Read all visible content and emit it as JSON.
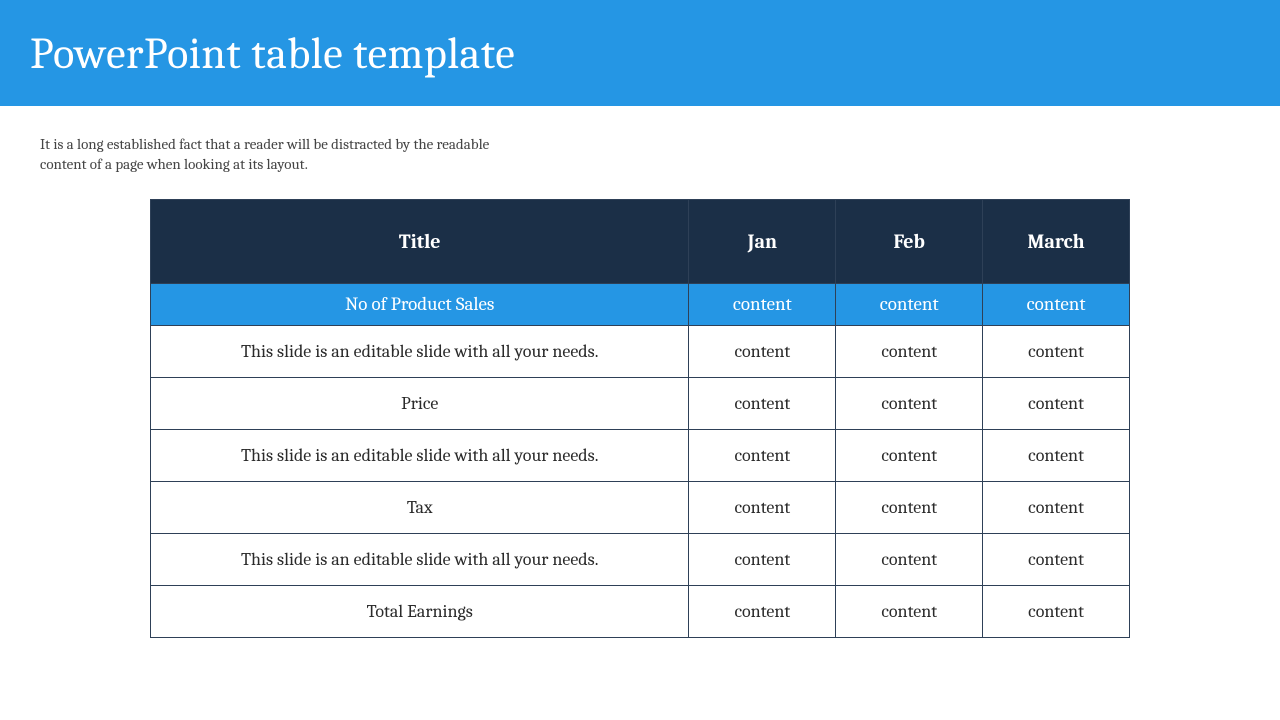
{
  "title": "PowerPoint table template",
  "subtitle": "It is a long established fact that a reader will be distracted by the readable content of a page when looking at its layout.",
  "table": {
    "headers": [
      "Title",
      "Jan",
      "Feb",
      "March"
    ],
    "rows": [
      {
        "highlight": true,
        "cells": [
          "No of Product Sales",
          "content",
          "content",
          "content"
        ]
      },
      {
        "highlight": false,
        "cells": [
          "This slide is an editable slide with all your needs.",
          "content",
          "content",
          "content"
        ]
      },
      {
        "highlight": false,
        "cells": [
          "Price",
          "content",
          "content",
          "content"
        ]
      },
      {
        "highlight": false,
        "cells": [
          "This slide is an editable slide with all your needs.",
          "content",
          "content",
          "content"
        ]
      },
      {
        "highlight": false,
        "cells": [
          "Tax",
          "content",
          "content",
          "content"
        ]
      },
      {
        "highlight": false,
        "cells": [
          "This slide is an editable slide with all your needs.",
          "content",
          "content",
          "content"
        ]
      },
      {
        "highlight": false,
        "cells": [
          "Total Earnings",
          "content",
          "content",
          "content"
        ]
      }
    ]
  }
}
